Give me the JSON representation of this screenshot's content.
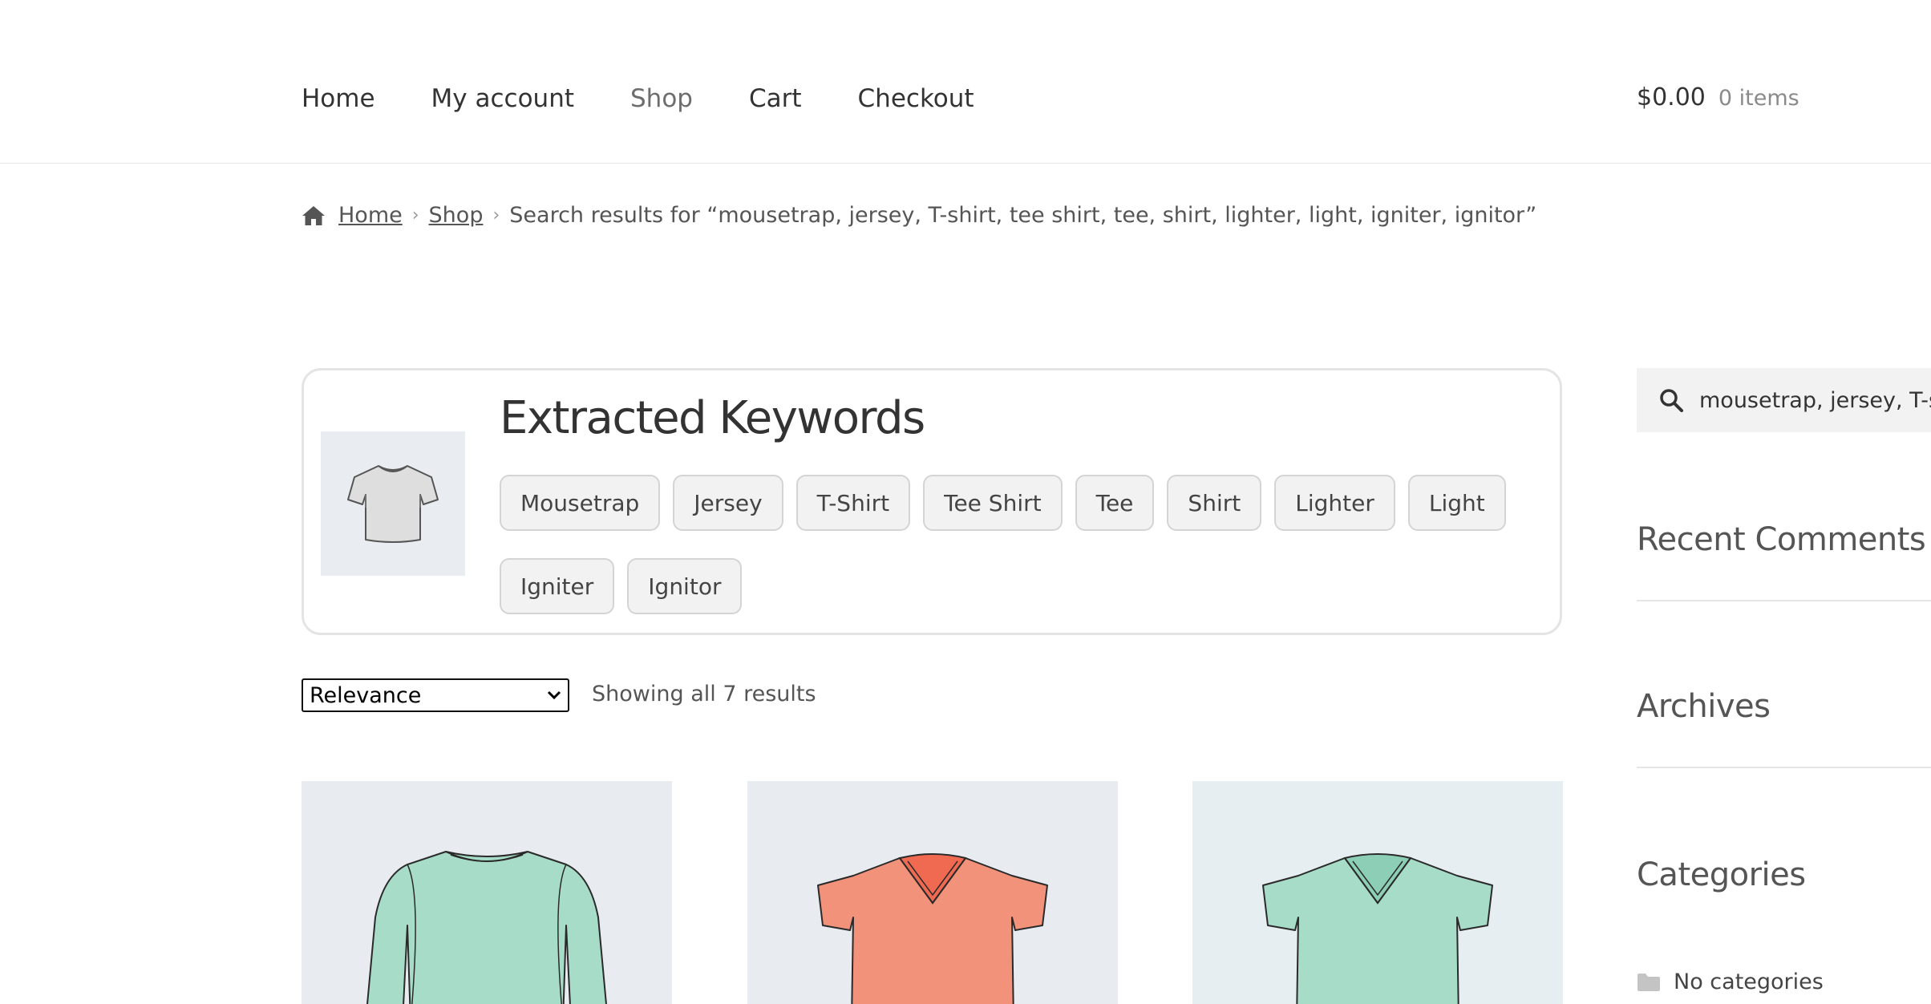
{
  "nav": {
    "items": [
      {
        "label": "Home"
      },
      {
        "label": "My account"
      },
      {
        "label": "Shop"
      },
      {
        "label": "Cart"
      },
      {
        "label": "Checkout"
      }
    ],
    "current": "Shop"
  },
  "cart": {
    "amount": "$0.00",
    "count": "0 items"
  },
  "breadcrumb": {
    "home": "Home",
    "shop": "Shop",
    "current": "Search results for “mousetrap, jersey, T-shirt, tee shirt, tee, shirt, lighter, light, igniter, ignitor”"
  },
  "keywords": {
    "title": "Extracted Keywords",
    "chips": [
      "Mousetrap",
      "Jersey",
      "T-Shirt",
      "Tee Shirt",
      "Tee",
      "Shirt",
      "Lighter",
      "Light",
      "Igniter",
      "Ignitor"
    ]
  },
  "sort": {
    "selected": "Relevance"
  },
  "results": {
    "count_text": "Showing all 7 results"
  },
  "products": [
    {
      "icon": "long-sleeve-shirt-icon",
      "color": "#a7dcc9"
    },
    {
      "icon": "v-neck-tshirt-icon",
      "color": "#f2927a"
    },
    {
      "icon": "v-neck-tshirt-icon",
      "color": "#a7dcc9"
    }
  ],
  "sidebar": {
    "search_value": "mousetrap, jersey, T-shirt, tee shirt, tee, shirt, lighter, light, igniter, ignitor",
    "recent_comments": "Recent Comments",
    "archives": "Archives",
    "categories": "Categories",
    "no_categories": "No categories"
  },
  "colors": {
    "text": "#333333",
    "muted": "#6d6d6d",
    "chip_bg": "#f2f2f2",
    "thumb_bg": "#e9edf2"
  }
}
